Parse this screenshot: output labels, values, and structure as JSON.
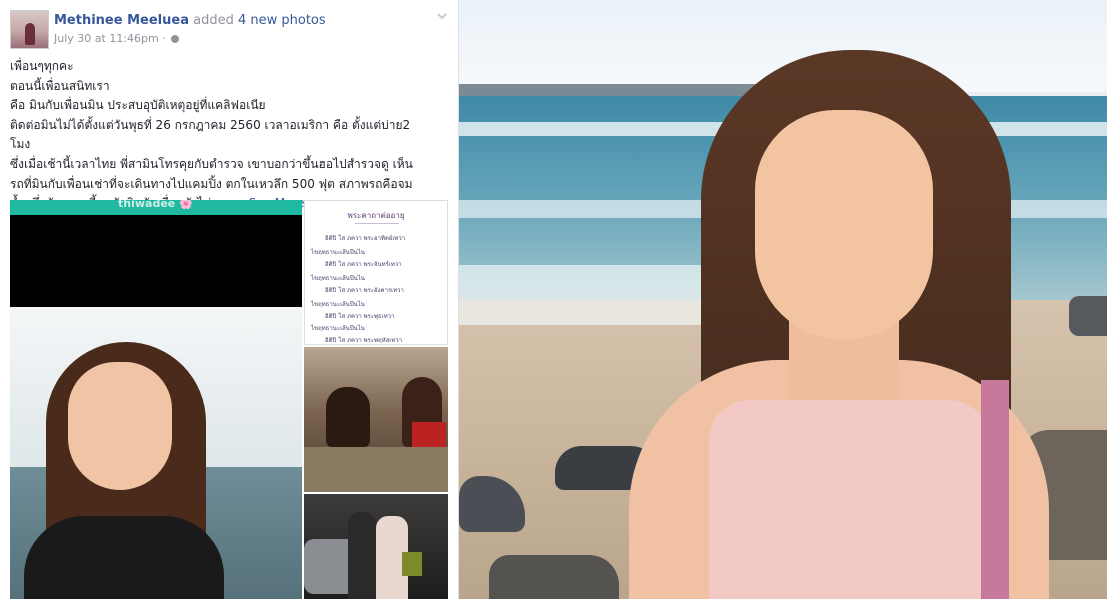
{
  "post": {
    "author": "Methinee Meeluea",
    "action": "added",
    "action_link": "4 new photos",
    "timestamp": "July 30 at 11:46pm",
    "separator": "·",
    "text_lines": [
      "เพื่อนๆทุกคะ",
      "ตอนนี้เพื่อนสนิทเรา",
      "คือ มินกับเพื่อนมิน ประสบอุบัติเหตุอยู่ที่แคลิฟอเนีย",
      "ติดต่อมินไม่ได้ตั้งแต่วันพุธที่ 26 กรกฎาคม 2560 เวลาอเมริกา คือ ตั้งแต่บ่าย2",
      "โมง",
      "ซึ่งเมื่อเช้านี้เวลาไทย พี่สามินโทรคุยกับตำรวจ เขาบอกว่าขึ้นฮอไปสำรวจดู เห็น",
      "รถที่มินกับเพื่อนเช่าที่จะเดินทางไปแคมปิ้ง ตกในเหวลึก 500 ฟุต สภาพรถคือจม",
      "น้ำครึ่งคัน ตอนนี้หาตัวมินกับเพื่อนยังไม่เจอ ..."
    ],
    "see_more": "See More"
  },
  "photos": {
    "big_top_label": "thiwadee 🌸",
    "doc_title": "พระคาถาต่ออายุ",
    "doc_lines": [
      "อิติปิ โส ภควา พระอาทิตย์เทวา",
      "ไขฤทธานะเส้นปีนไน",
      "อิติปิ โส ภควา พระจันทร์เทวา",
      "ไขฤทธานะเส้นปีนไน",
      "อิติปิ โส ภควา พระอังคารเทวา",
      "ไขฤทธานะเส้นปีนไน",
      "อิติปิ โส ภควา พระพุธเทวา",
      "ไขฤทธานะเส้นปีนไน",
      "อิติปิ โส ภควา พระพฤหัสเทวา"
    ]
  },
  "colors": {
    "link": "#365899",
    "meta": "#90949c",
    "text": "#1d2129",
    "app_bar": "#1fb8a0"
  },
  "icons": {
    "globe": "globe-icon",
    "chevron": "chevron-down-icon"
  }
}
